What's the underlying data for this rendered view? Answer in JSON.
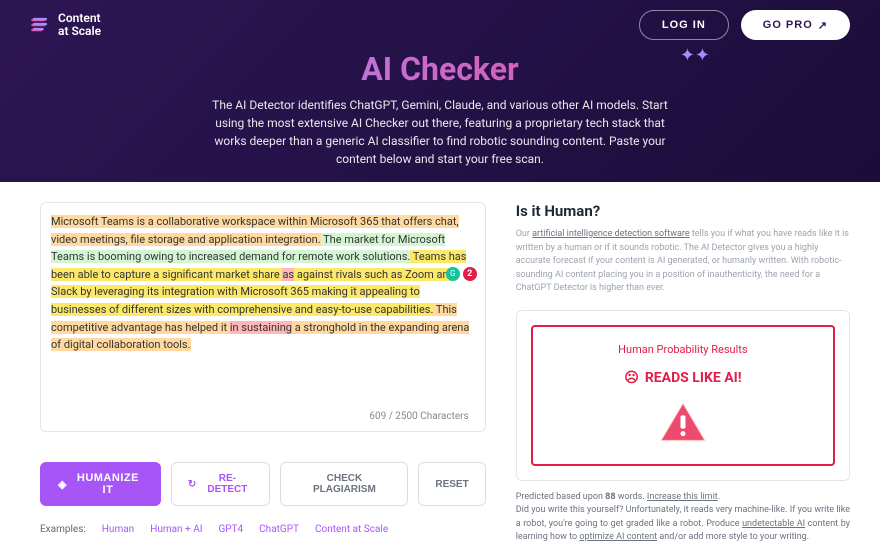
{
  "nav": {
    "brand1": "Content",
    "brand2": "at Scale",
    "login": "LOG IN",
    "gopro": "GO PRO"
  },
  "hero": {
    "title": "AI Checker",
    "desc": "The AI Detector identifies ChatGPT, Gemini, Claude, and various other AI models. Start using the most extensive AI Checker out there, featuring a proprietary tech stack that works deeper than a generic AI classifier to find robotic sounding content. Paste your content below and start your free scan."
  },
  "text": {
    "s1": "Microsoft Teams is a collaborative workspace within Microsoft 365 that offers chat, video meetings, file storage and application integration.",
    "s2": " The market for Microsoft Teams is booming owing to increased demand for remote work solutions.",
    "s3a": " Teams has been able to capture a significant market share ",
    "s3b": "as",
    "s3c": " against rivals such as Zoom and Slack by leveraging its integration with Microsoft 365 making it appealing to businesses of different sizes with comprehensive and easy-to-use capabilities.",
    "s4a": " This competitive advantage has helped it ",
    "s4b": "in sustaining",
    "s4c": " a stronghold in the expanding arena of digital collaboration tools."
  },
  "grammarly_count": "2",
  "char_count": "609 / 2500 Characters",
  "actions": {
    "humanize": "HUMANIZE IT",
    "redetect": "RE-DETECT",
    "plagiarism": "CHECK PLAGIARISM",
    "reset": "RESET"
  },
  "examples": {
    "label": "Examples:",
    "e1": "Human",
    "e2": "Human + AI",
    "e3": "GPT4",
    "e4": "ChatGPT",
    "e5": "Content at Scale"
  },
  "right": {
    "title": "Is it Human?",
    "desc1": "Our ",
    "desc1a": "artificial intelligence detection software",
    "desc2": " tells you if what you have reads like it is written by a human or if it sounds robotic. The AI Detector gives you a highly accurate forecast if your content is AI generated, or humanly written. With robotic-sounding AI content placing you in a position of inauthenticity, the need for a ChatGPT Detector is higher than ever.",
    "result_label": "Human Probability Results",
    "verdict": "READS LIKE AI!",
    "pred1": "Predicted based upon ",
    "pred_words": "88",
    "pred2": " words. ",
    "pred_link1": "Increase this limit",
    "pred3": ".",
    "pred4": "Did you write this yourself? Unfortunately, it reads very machine-like. If you write like a robot, you're going to get graded like a robot. Produce ",
    "pred_link2": "undetectable AI",
    "pred5": " content by learning how to ",
    "pred_link3": "optimize AI content",
    "pred6": " and/or add more style to your writing."
  }
}
